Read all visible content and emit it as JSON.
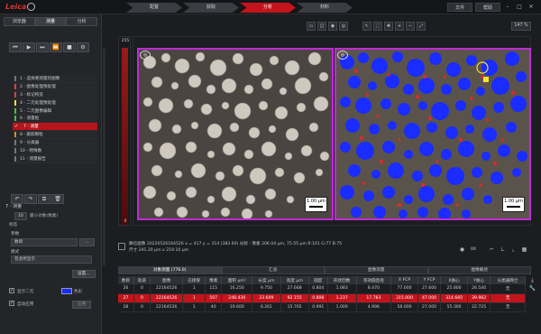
{
  "topbar": {
    "tabs": [
      {
        "label": "配置"
      },
      {
        "label": "获取"
      },
      {
        "label": "分析"
      },
      {
        "label": "材料"
      }
    ],
    "active_tab": "分析",
    "buttons": [
      {
        "label": "文件"
      },
      {
        "label": "帮助"
      }
    ]
  },
  "left_tabs": [
    {
      "label": "浏览器"
    },
    {
      "label": "测量"
    },
    {
      "label": "分析"
    }
  ],
  "steps": [
    {
      "label": "1 - 选择要测量的图像",
      "color": "#777777"
    },
    {
      "label": "2 - 图像处理预处理",
      "color": "#e04040"
    },
    {
      "label": "3 - 标记构造",
      "color": "#e04040"
    },
    {
      "label": "4 - 二元处理预处理",
      "color": "#f2e23a"
    },
    {
      "label": "5 - 二元图像编辑",
      "color": "#44c144"
    },
    {
      "label": "6 - 测量框",
      "color": "#44c144"
    },
    {
      "label": "7 - 测量",
      "color": "#ffffff"
    },
    {
      "label": "8 - 跟踪颗粒",
      "color": "#e08a2a"
    },
    {
      "label": "9 - 分类器",
      "color": "#777777"
    },
    {
      "label": "10 - 特殊数",
      "color": "#777777"
    },
    {
      "label": "11 - 测量报告",
      "color": "#777777"
    }
  ],
  "active_step_index": 6,
  "section": {
    "title": "7 - 测量"
  },
  "panel": {
    "count_value": "10",
    "count_label": "最小对象(像素)",
    "label_group": "标签",
    "param_label": "参数",
    "param_value": "数目",
    "mode_label": "模式",
    "mode_value": "包含所显示",
    "setup_button": "设置...",
    "show_binary_label": "显示二元",
    "color_label": "色彩",
    "auto_apply_label": "自动应用",
    "apply_button": "应用"
  },
  "histogram": {
    "top": "255",
    "bottom": "0"
  },
  "viewer": {
    "zoom": "147 %",
    "scalebar_left": "1.00 µm",
    "scalebar_right": "1.00 µm"
  },
  "info": {
    "line1": "舞信图像 20220526164526  x = 417 y = 314 (383 60)  光标 : 像素 206.04 µm, 75.55 µm   R:101 G:77 B:75",
    "line2": "尺寸 291.20 µm x 219.10 µm",
    "zero_label": "0X"
  },
  "table_tabs": [
    {
      "label": "对象测量 (776.0)"
    },
    {
      "label": "汇总"
    },
    {
      "label": "图像测量"
    },
    {
      "label": "图像概述"
    }
  ],
  "table": {
    "headers": [
      "数目",
      "轨道",
      "图像",
      "已接受",
      "像素",
      "面积 µm²",
      "长度 µm",
      "宽度 µm",
      "圆度",
      "形状因数",
      "等效圆直径",
      "X FCP",
      "Y FCP",
      "X质心",
      "Y质心",
      "分类器网兰"
    ],
    "rows": [
      [
        "26",
        "0",
        "22164526",
        "1",
        "115",
        "16.250",
        "9.750",
        "27.668",
        "0.804",
        "1.083",
        "8.470",
        "77.000",
        "27.600",
        "25.800",
        "26.540",
        "无"
      ],
      [
        "27",
        "0",
        "22164526",
        "1",
        "507",
        "248.430",
        "23.609",
        "92.155",
        "0.808",
        "1.237",
        "17.783",
        "315.000",
        "47.000",
        "314.660",
        "39.982",
        "无"
      ],
      [
        "28",
        "0",
        "22164526",
        "1",
        "40",
        "19.600",
        "6.261",
        "15.765",
        "0.991",
        "1.009",
        "4.996",
        "58.000",
        "27.000",
        "55.300",
        "22.725",
        "无"
      ]
    ],
    "selected_row_index": 1
  },
  "colors": {
    "accent": "#c3141c",
    "overlay_frame": "#c02bd6",
    "binary_blue": "#1a2cff"
  }
}
